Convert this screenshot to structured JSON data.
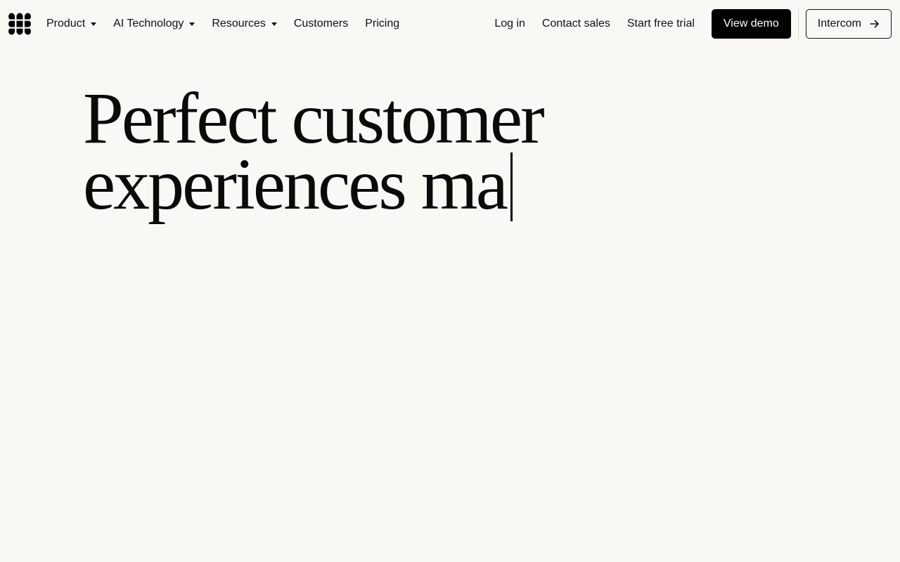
{
  "nav": {
    "logo_icon": "intercom-logo-icon",
    "left_items": [
      {
        "label": "Product",
        "has_dropdown": true
      },
      {
        "label": "AI Technology",
        "has_dropdown": true
      },
      {
        "label": "Resources",
        "has_dropdown": true
      },
      {
        "label": "Customers",
        "has_dropdown": false
      },
      {
        "label": "Pricing",
        "has_dropdown": false
      }
    ],
    "login_label": "Log in",
    "contact_sales_label": "Contact sales",
    "free_trial_label": "Start free trial",
    "view_demo_label": "View demo",
    "intercom_label": "Intercom",
    "intercom_icon": "arrow-right-icon"
  },
  "hero": {
    "line1": "Perfect customer",
    "line2": "experiences ma"
  },
  "colors": {
    "background": "#f9f8f5",
    "text": "#0a0a0a",
    "demo_button_bg": "#000000"
  }
}
